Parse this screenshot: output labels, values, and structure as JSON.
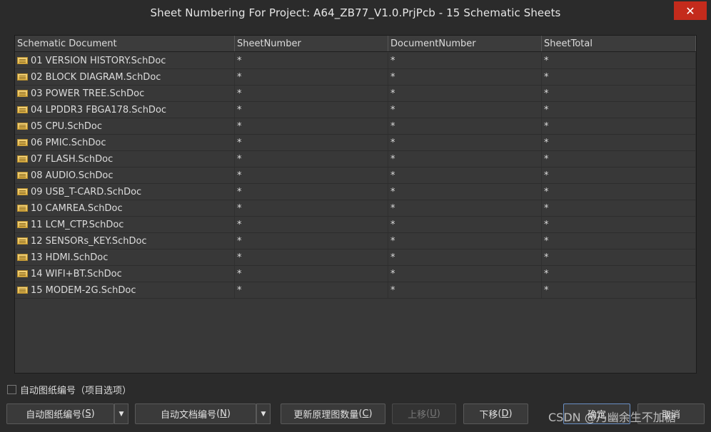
{
  "window": {
    "title": "Sheet Numbering For Project: A64_ZB77_V1.0.PrjPcb  - 15 Schematic Sheets",
    "close_glyph": "✕"
  },
  "table": {
    "columns": [
      "Schematic Document",
      "SheetNumber",
      "DocumentNumber",
      "SheetTotal"
    ],
    "rows": [
      {
        "doc": "01 VERSION HISTORY.SchDoc",
        "sheet": "*",
        "docnum": "*",
        "total": "*"
      },
      {
        "doc": "02 BLOCK DIAGRAM.SchDoc",
        "sheet": "*",
        "docnum": "*",
        "total": "*"
      },
      {
        "doc": "03 POWER TREE.SchDoc",
        "sheet": "*",
        "docnum": "*",
        "total": "*"
      },
      {
        "doc": "04 LPDDR3 FBGA178.SchDoc",
        "sheet": "*",
        "docnum": "*",
        "total": "*"
      },
      {
        "doc": "05 CPU.SchDoc",
        "sheet": "*",
        "docnum": "*",
        "total": "*"
      },
      {
        "doc": "06 PMIC.SchDoc",
        "sheet": "*",
        "docnum": "*",
        "total": "*"
      },
      {
        "doc": "07 FLASH.SchDoc",
        "sheet": "*",
        "docnum": "*",
        "total": "*"
      },
      {
        "doc": "08 AUDIO.SchDoc",
        "sheet": "*",
        "docnum": "*",
        "total": "*"
      },
      {
        "doc": "09 USB_T-CARD.SchDoc",
        "sheet": "*",
        "docnum": "*",
        "total": "*"
      },
      {
        "doc": "10 CAMREA.SchDoc",
        "sheet": "*",
        "docnum": "*",
        "total": "*"
      },
      {
        "doc": "11 LCM_CTP.SchDoc",
        "sheet": "*",
        "docnum": "*",
        "total": "*"
      },
      {
        "doc": "12 SENSORs_KEY.SchDoc",
        "sheet": "*",
        "docnum": "*",
        "total": "*"
      },
      {
        "doc": "13 HDMI.SchDoc",
        "sheet": "*",
        "docnum": "*",
        "total": "*"
      },
      {
        "doc": "14 WIFI+BT.SchDoc",
        "sheet": "*",
        "docnum": "*",
        "total": "*"
      },
      {
        "doc": "15 MODEM-2G.SchDoc",
        "sheet": "*",
        "docnum": "*",
        "total": "*"
      }
    ],
    "row_icon": "schematic-sheet-icon"
  },
  "options": {
    "auto_sheet_numbering_checkbox_label": "自动图纸编号（项目选项）",
    "checked": false
  },
  "buttons": {
    "auto_sheet_number": {
      "label": "自动图纸编号 ",
      "hotkey": "S"
    },
    "auto_doc_number": {
      "label": "自动文档编号 ",
      "hotkey": "N"
    },
    "update_sheet_count": {
      "label": "更新原理图数量 ",
      "hotkey": "C"
    },
    "move_up": {
      "label": "上移 ",
      "hotkey": "U"
    },
    "move_down": {
      "label": "下移 ",
      "hotkey": "D"
    },
    "ok": {
      "label": "确定"
    },
    "cancel": {
      "label": "取消"
    },
    "dropdown_glyph": "▼"
  },
  "watermark": "CSDN @乃幽余生不加糖",
  "colors": {
    "background": "#2b2b2b",
    "grid": "#383838",
    "close": "#c42b1c",
    "sheet_icon": "#e8b94a"
  }
}
